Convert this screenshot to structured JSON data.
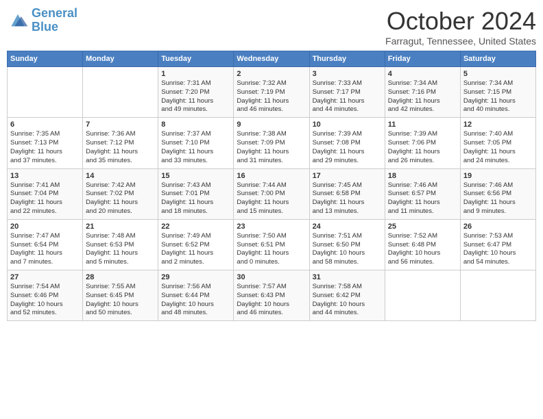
{
  "header": {
    "logo_line1": "General",
    "logo_line2": "Blue",
    "month": "October 2024",
    "location": "Farragut, Tennessee, United States"
  },
  "days_of_week": [
    "Sunday",
    "Monday",
    "Tuesday",
    "Wednesday",
    "Thursday",
    "Friday",
    "Saturday"
  ],
  "weeks": [
    [
      {
        "day": "",
        "content": ""
      },
      {
        "day": "",
        "content": ""
      },
      {
        "day": "1",
        "content": "Sunrise: 7:31 AM\nSunset: 7:20 PM\nDaylight: 11 hours\nand 49 minutes."
      },
      {
        "day": "2",
        "content": "Sunrise: 7:32 AM\nSunset: 7:19 PM\nDaylight: 11 hours\nand 46 minutes."
      },
      {
        "day": "3",
        "content": "Sunrise: 7:33 AM\nSunset: 7:17 PM\nDaylight: 11 hours\nand 44 minutes."
      },
      {
        "day": "4",
        "content": "Sunrise: 7:34 AM\nSunset: 7:16 PM\nDaylight: 11 hours\nand 42 minutes."
      },
      {
        "day": "5",
        "content": "Sunrise: 7:34 AM\nSunset: 7:15 PM\nDaylight: 11 hours\nand 40 minutes."
      }
    ],
    [
      {
        "day": "6",
        "content": "Sunrise: 7:35 AM\nSunset: 7:13 PM\nDaylight: 11 hours\nand 37 minutes."
      },
      {
        "day": "7",
        "content": "Sunrise: 7:36 AM\nSunset: 7:12 PM\nDaylight: 11 hours\nand 35 minutes."
      },
      {
        "day": "8",
        "content": "Sunrise: 7:37 AM\nSunset: 7:10 PM\nDaylight: 11 hours\nand 33 minutes."
      },
      {
        "day": "9",
        "content": "Sunrise: 7:38 AM\nSunset: 7:09 PM\nDaylight: 11 hours\nand 31 minutes."
      },
      {
        "day": "10",
        "content": "Sunrise: 7:39 AM\nSunset: 7:08 PM\nDaylight: 11 hours\nand 29 minutes."
      },
      {
        "day": "11",
        "content": "Sunrise: 7:39 AM\nSunset: 7:06 PM\nDaylight: 11 hours\nand 26 minutes."
      },
      {
        "day": "12",
        "content": "Sunrise: 7:40 AM\nSunset: 7:05 PM\nDaylight: 11 hours\nand 24 minutes."
      }
    ],
    [
      {
        "day": "13",
        "content": "Sunrise: 7:41 AM\nSunset: 7:04 PM\nDaylight: 11 hours\nand 22 minutes."
      },
      {
        "day": "14",
        "content": "Sunrise: 7:42 AM\nSunset: 7:02 PM\nDaylight: 11 hours\nand 20 minutes."
      },
      {
        "day": "15",
        "content": "Sunrise: 7:43 AM\nSunset: 7:01 PM\nDaylight: 11 hours\nand 18 minutes."
      },
      {
        "day": "16",
        "content": "Sunrise: 7:44 AM\nSunset: 7:00 PM\nDaylight: 11 hours\nand 15 minutes."
      },
      {
        "day": "17",
        "content": "Sunrise: 7:45 AM\nSunset: 6:58 PM\nDaylight: 11 hours\nand 13 minutes."
      },
      {
        "day": "18",
        "content": "Sunrise: 7:46 AM\nSunset: 6:57 PM\nDaylight: 11 hours\nand 11 minutes."
      },
      {
        "day": "19",
        "content": "Sunrise: 7:46 AM\nSunset: 6:56 PM\nDaylight: 11 hours\nand 9 minutes."
      }
    ],
    [
      {
        "day": "20",
        "content": "Sunrise: 7:47 AM\nSunset: 6:54 PM\nDaylight: 11 hours\nand 7 minutes."
      },
      {
        "day": "21",
        "content": "Sunrise: 7:48 AM\nSunset: 6:53 PM\nDaylight: 11 hours\nand 5 minutes."
      },
      {
        "day": "22",
        "content": "Sunrise: 7:49 AM\nSunset: 6:52 PM\nDaylight: 11 hours\nand 2 minutes."
      },
      {
        "day": "23",
        "content": "Sunrise: 7:50 AM\nSunset: 6:51 PM\nDaylight: 11 hours\nand 0 minutes."
      },
      {
        "day": "24",
        "content": "Sunrise: 7:51 AM\nSunset: 6:50 PM\nDaylight: 10 hours\nand 58 minutes."
      },
      {
        "day": "25",
        "content": "Sunrise: 7:52 AM\nSunset: 6:48 PM\nDaylight: 10 hours\nand 56 minutes."
      },
      {
        "day": "26",
        "content": "Sunrise: 7:53 AM\nSunset: 6:47 PM\nDaylight: 10 hours\nand 54 minutes."
      }
    ],
    [
      {
        "day": "27",
        "content": "Sunrise: 7:54 AM\nSunset: 6:46 PM\nDaylight: 10 hours\nand 52 minutes."
      },
      {
        "day": "28",
        "content": "Sunrise: 7:55 AM\nSunset: 6:45 PM\nDaylight: 10 hours\nand 50 minutes."
      },
      {
        "day": "29",
        "content": "Sunrise: 7:56 AM\nSunset: 6:44 PM\nDaylight: 10 hours\nand 48 minutes."
      },
      {
        "day": "30",
        "content": "Sunrise: 7:57 AM\nSunset: 6:43 PM\nDaylight: 10 hours\nand 46 minutes."
      },
      {
        "day": "31",
        "content": "Sunrise: 7:58 AM\nSunset: 6:42 PM\nDaylight: 10 hours\nand 44 minutes."
      },
      {
        "day": "",
        "content": ""
      },
      {
        "day": "",
        "content": ""
      }
    ]
  ]
}
